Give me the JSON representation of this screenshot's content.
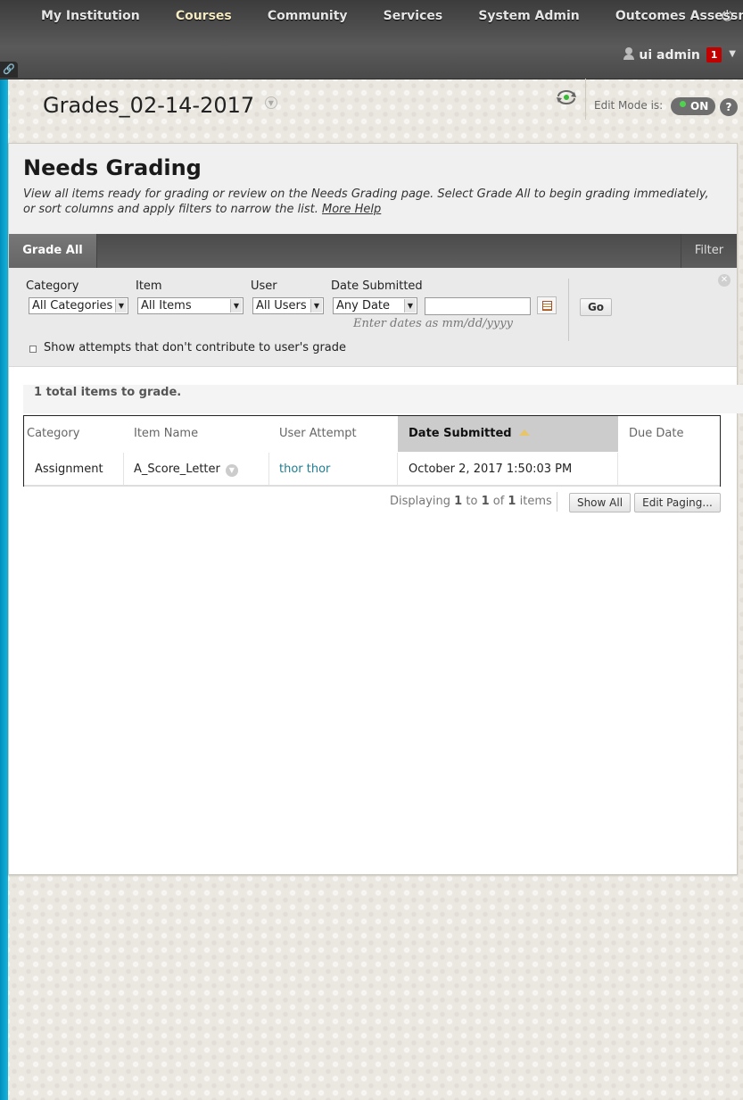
{
  "nav": {
    "tabs": [
      "My Institution",
      "Courses",
      "Community",
      "Services",
      "System Admin",
      "Outcomes Assessme"
    ],
    "active_tab": "Courses",
    "user_name": "ui admin",
    "notification_count": "1",
    "link_icon": "link-icon",
    "power_icon": "power-icon"
  },
  "course": {
    "title": "Grades_02-14-2017",
    "edit_mode_label": "Edit Mode is:",
    "edit_mode_state": "ON",
    "help_label": "?"
  },
  "page": {
    "title": "Needs Grading",
    "description": "View all items ready for grading or review on the Needs Grading page. Select Grade All to begin grading immediately, or sort columns and apply filters to narrow the list.",
    "more_help": "More Help"
  },
  "actions": {
    "grade_all": "Grade All",
    "filter": "Filter"
  },
  "filters": {
    "category_label": "Category",
    "category_value": "All Categories",
    "item_label": "Item",
    "item_value": "All Items",
    "user_label": "User",
    "user_value": "All Users",
    "date_label": "Date Submitted",
    "date_value": "Any Date",
    "date_input": "",
    "date_hint": "Enter dates as mm/dd/yyyy",
    "go": "Go",
    "show_attempts": "Show attempts that don't contribute to user's grade"
  },
  "summary": {
    "total": "1 total items to grade."
  },
  "table": {
    "columns": [
      "Category",
      "Item Name",
      "User Attempt",
      "Date Submitted",
      "Due Date"
    ],
    "sorted_column": "Date Submitted",
    "rows": [
      {
        "category": "Assignment",
        "item_name": "A_Score_Letter",
        "user_attempt": "thor thor",
        "date_submitted": "October 2, 2017 1:50:03 PM",
        "due_date": ""
      }
    ]
  },
  "paging": {
    "prefix": "Displaying",
    "from": "1",
    "to_word": "to",
    "to": "1",
    "of_word": "of",
    "total": "1",
    "suffix": "items",
    "show_all": "Show All",
    "edit_paging": "Edit Paging..."
  },
  "colors": {
    "accent_strip": "#16b5dd",
    "active_tab": "#f4ebc3",
    "link": "#1d7e92",
    "badge": "#c10000",
    "edit_on_dot": "#4fd34f"
  }
}
